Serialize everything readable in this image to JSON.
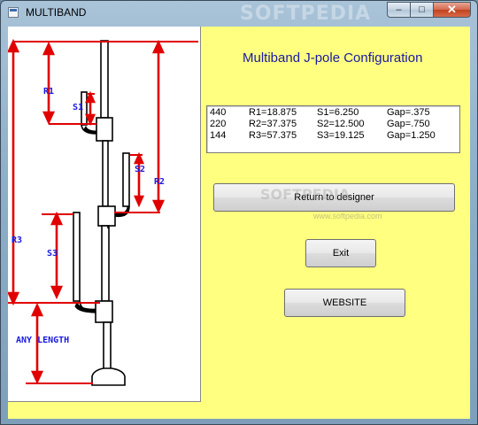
{
  "window": {
    "title": "MULTIBAND",
    "watermark": "SOFTPEDIA",
    "buttons": {
      "minimize": "–",
      "maximize": "□",
      "close": "✕"
    }
  },
  "form": {
    "title": "Multiband J-pole Configuration"
  },
  "results": {
    "rows": [
      {
        "band": "440",
        "r": "R1=18.875",
        "s": "S1=6.250",
        "gap": "Gap=.375"
      },
      {
        "band": "220",
        "r": "R2=37.375",
        "s": "S2=12.500",
        "gap": "Gap=.750"
      },
      {
        "band": "144",
        "r": "R3=57.375",
        "s": "S3=19.125",
        "gap": "Gap=1.250"
      }
    ]
  },
  "buttons": {
    "return_label": "Return to designer",
    "exit_label": "Exit",
    "website_label": "WEBSITE"
  },
  "diagram": {
    "labels": {
      "r1": "R1",
      "s1": "S1",
      "s2": "S2",
      "r2": "R2",
      "r3": "R3",
      "s3": "S3",
      "any_length": "ANY LENGTH"
    }
  },
  "overlay": {
    "softpedia": "SOFTPEDIA",
    "softpedia_url": "www.softpedia.com"
  },
  "colors": {
    "client_background": "#ffff80",
    "form_title": "#1a1aa0",
    "dimension_lines": "#e00000",
    "diagram_labels": "#1a1ae0"
  }
}
